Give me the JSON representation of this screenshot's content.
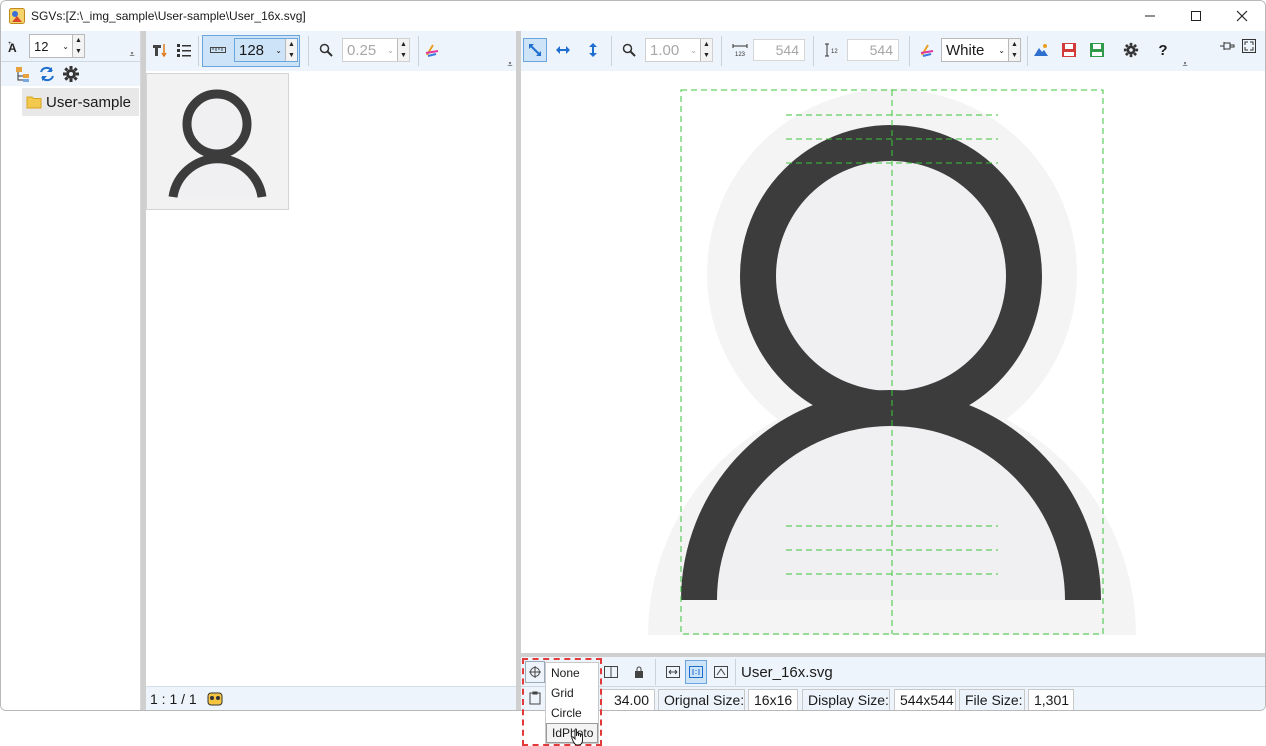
{
  "window": {
    "title": "SGVs:[Z:\\_img_sample\\User-sample\\User_16x.svg]",
    "controls": [
      "minimize-icon",
      "maximize-icon",
      "close-icon"
    ]
  },
  "tree_toolbar": {
    "font_size": "12",
    "icons": [
      "font-size-icon",
      "tree-view-icon",
      "refresh-icon",
      "settings-icon"
    ]
  },
  "tree": {
    "items": [
      {
        "label": "User-sample",
        "icon": "folder-icon"
      }
    ]
  },
  "thumb_toolbar": {
    "thumb_size": "128",
    "zoom": "0.25",
    "icons": [
      "sort-icon",
      "list-icon",
      "ruler-icon",
      "zoom-icon",
      "color-icon"
    ]
  },
  "thumb_status": {
    "position": "1 : 1 / 1"
  },
  "view_toolbar": {
    "zoom": "1.00",
    "width": "544",
    "height": "544",
    "background": "White",
    "icons": [
      "fit-diagonal-icon",
      "fit-width-icon",
      "fit-height-icon",
      "zoom-icon",
      "width-icon",
      "height-icon",
      "color-icon",
      "image-icon",
      "save-red-icon",
      "save-green-icon",
      "settings-icon",
      "help-icon",
      "pin-icon",
      "fullscreen-icon"
    ]
  },
  "view_status": {
    "filename": "User_16x.svg",
    "zoom_value": "34.00",
    "original_size_label": "Orignal Size:",
    "original_size": "16x16",
    "display_size_label": "Display Size:",
    "display_size": "544x544",
    "file_size_label": "File Size:",
    "file_size": "1,301"
  },
  "guide_menu": {
    "options": [
      "None",
      "Grid",
      "Circle",
      "IdPhoto"
    ],
    "selected": "IdPhoto"
  },
  "colors": {
    "toolbar_bg": "#eef4fb",
    "icon_fill": "#3c3c3c",
    "icon_bg": "#f0eff1",
    "guide": "#3cc43c",
    "highlight": "#e23a3a"
  }
}
